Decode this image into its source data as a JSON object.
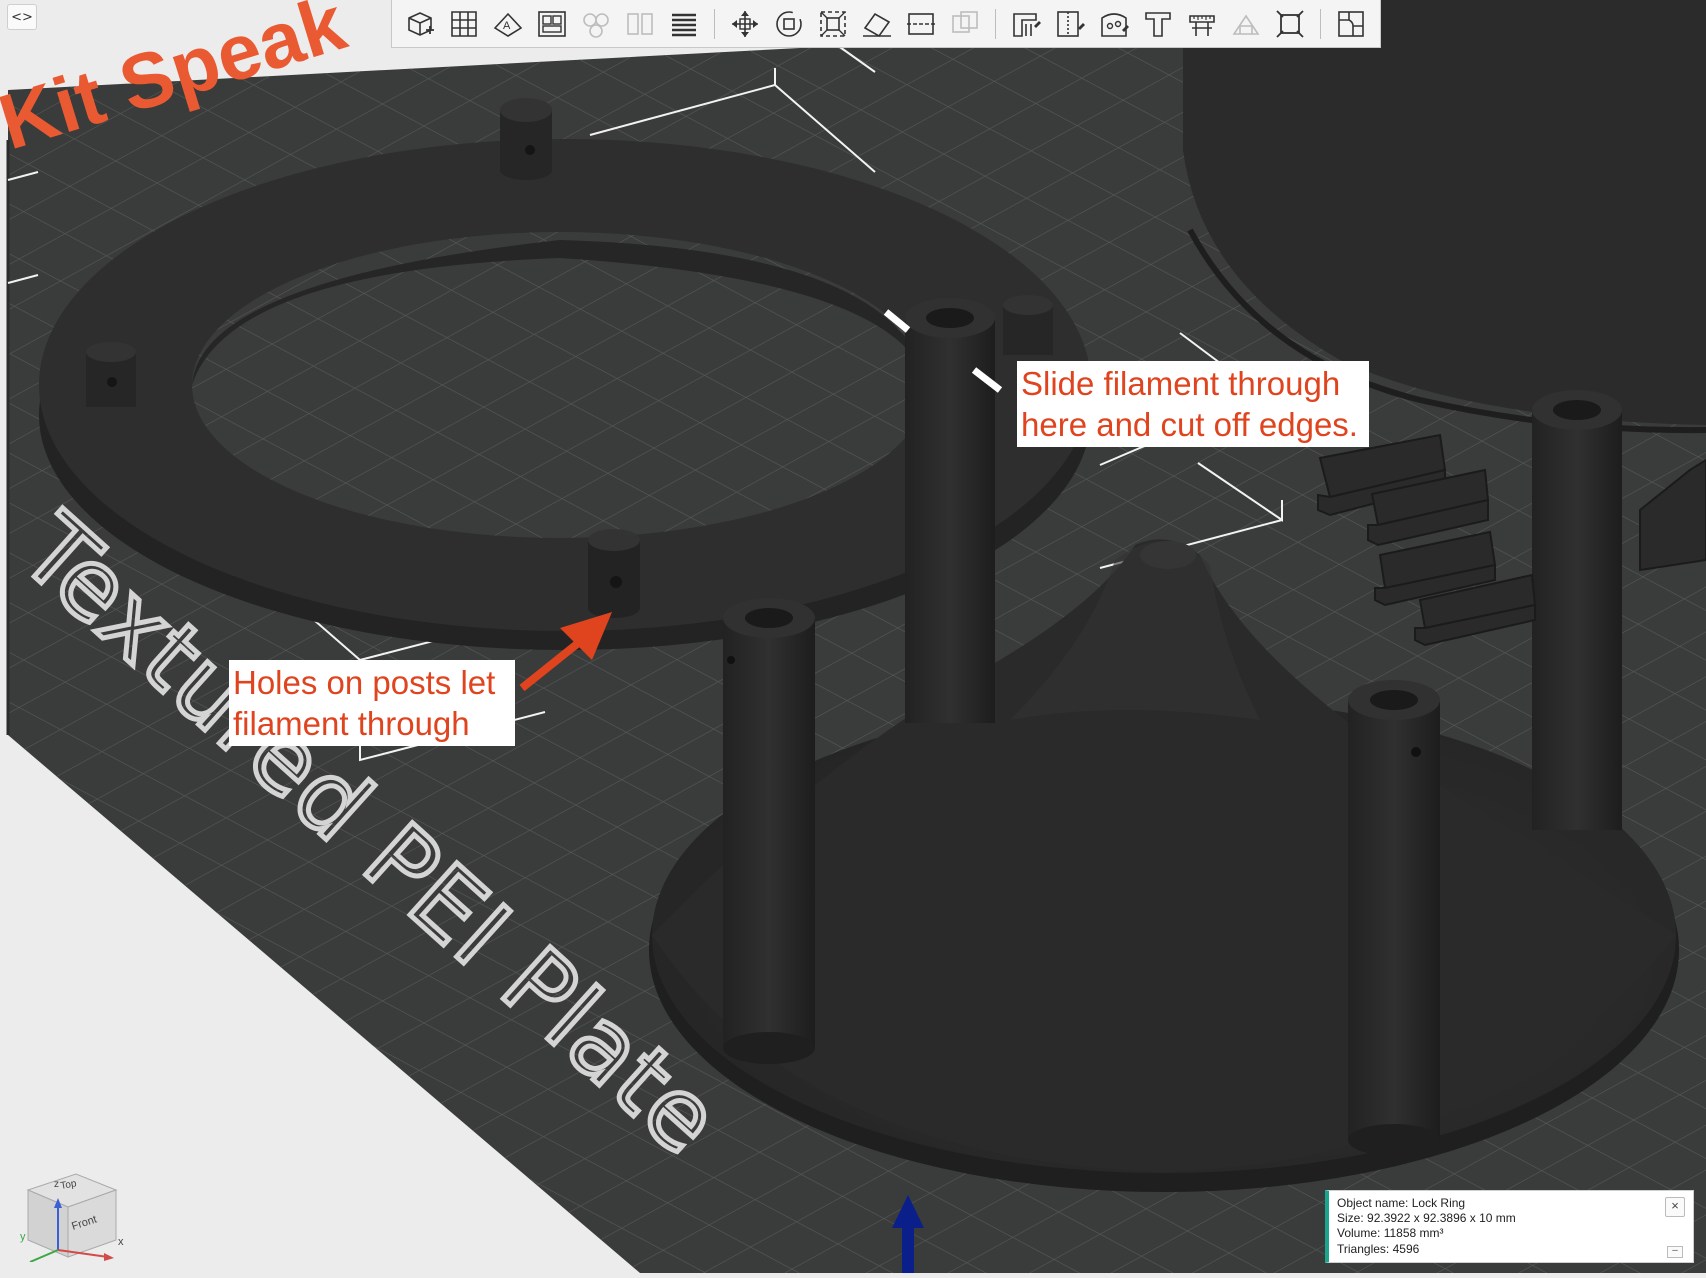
{
  "viewport": {
    "brand_text": "Kit Speak",
    "plate_label": "Textured PEI Plate",
    "colors": {
      "bed": "#3a3b3b",
      "offbed": "#ececec",
      "model": "#2a2a2a",
      "brand": "#ea5a32",
      "accent": "#e0441f"
    }
  },
  "toolbar": {
    "items": [
      {
        "name": "add-object-icon"
      },
      {
        "name": "arrange-grid-icon"
      },
      {
        "name": "auto-orient-icon"
      },
      {
        "name": "plate-view-icon"
      },
      {
        "name": "split-objects-icon",
        "disabled": true
      },
      {
        "name": "split-parts-icon",
        "disabled": true
      },
      {
        "name": "layers-icon"
      },
      {
        "name": "move-icon"
      },
      {
        "name": "rotate-icon"
      },
      {
        "name": "scale-icon"
      },
      {
        "name": "lay-on-face-icon"
      },
      {
        "name": "cut-icon"
      },
      {
        "name": "boolean-icon",
        "disabled": true
      },
      {
        "name": "support-paint-icon"
      },
      {
        "name": "seam-paint-icon"
      },
      {
        "name": "color-paint-icon"
      },
      {
        "name": "text-emboss-icon"
      },
      {
        "name": "measure-icon"
      },
      {
        "name": "assembly-icon",
        "disabled": true
      },
      {
        "name": "fit-view-icon"
      },
      {
        "name": "variable-layer-icon"
      }
    ]
  },
  "annotations": {
    "holes": "Holes on posts let\nfilament through",
    "slide": "Slide filament through\nhere and cut off edges."
  },
  "object_info": {
    "name_label": "Object name:",
    "name": "Lock Ring",
    "size_label": "Size:",
    "size": "92.3922 x 92.3896 x 10 mm",
    "volume_label": "Volume:",
    "volume": "11858 mm³",
    "triangles_label": "Triangles:",
    "triangles": "4596",
    "close": "×",
    "minimize": "–"
  },
  "navcube": {
    "top": "Top",
    "front": "Front",
    "axis_x": "x",
    "axis_y": "y",
    "axis_z": "z"
  },
  "collapse_button": "<>"
}
